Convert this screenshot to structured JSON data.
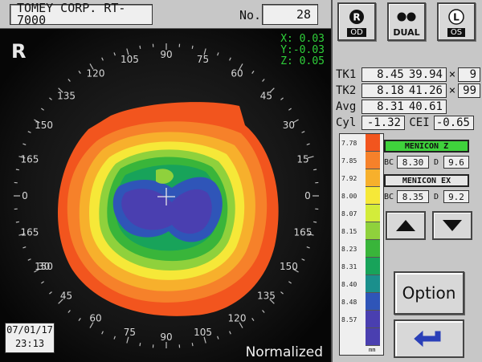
{
  "header": {
    "model": "TOMEY CORP. RT-7000",
    "no_label": "No.",
    "no_value": "28"
  },
  "map": {
    "eye": "R",
    "coords": {
      "x": "X: 0.03",
      "y": "Y:-0.03",
      "z": "Z: 0.05"
    },
    "date": "07/01/17",
    "time": "23:13",
    "mode": "Normalized",
    "angles": [
      "90",
      "105",
      "120",
      "135",
      "150",
      "165",
      "0",
      "165",
      "150",
      "135",
      "120",
      "105",
      "90",
      "75",
      "60",
      "45",
      "30",
      "15",
      "0",
      "15",
      "30",
      "45",
      "60",
      "75"
    ],
    "angle_ticks": [
      {
        "t": "90",
        "a": 90
      },
      {
        "t": "105",
        "a": 105
      },
      {
        "t": "120",
        "a": 120
      },
      {
        "t": "135",
        "a": 135
      },
      {
        "t": "150",
        "a": 150
      },
      {
        "t": "165",
        "a": 165
      },
      {
        "t": "0",
        "a": 180
      },
      {
        "t": "165",
        "a": 195
      },
      {
        "t": "150",
        "a": 210
      },
      {
        "t": "45",
        "a": 225
      },
      {
        "t": "30",
        "a": 210
      },
      {
        "t": "60",
        "a": 240
      },
      {
        "t": "75",
        "a": 255
      },
      {
        "t": "90",
        "a": 270
      },
      {
        "t": "105",
        "a": 285
      },
      {
        "t": "120",
        "a": 300
      },
      {
        "t": "135",
        "a": 315
      },
      {
        "t": "150",
        "a": 330
      },
      {
        "t": "165",
        "a": 345
      },
      {
        "t": "0",
        "a": 0
      },
      {
        "t": "15",
        "a": 15
      },
      {
        "t": "30",
        "a": 30
      },
      {
        "t": "45",
        "a": 45
      },
      {
        "t": "60",
        "a": 60
      },
      {
        "t": "75",
        "a": 75
      }
    ]
  },
  "eye_buttons": {
    "od": {
      "letter": "R",
      "label": "OD"
    },
    "dual": {
      "label": "DUAL"
    },
    "os": {
      "letter": "L",
      "label": "OS"
    }
  },
  "keratometry": {
    "tk1": {
      "label": "TK1",
      "r": "8.45",
      "d": "39.94",
      "axis": "9"
    },
    "tk2": {
      "label": "TK2",
      "r": "8.18",
      "d": "41.26",
      "axis": "99"
    },
    "avg": {
      "label": "Avg",
      "r": "8.31",
      "d": "40.61"
    },
    "cyl": {
      "label": "Cyl",
      "value": "-1.32"
    },
    "cei": {
      "label": "CEI",
      "value": "-0.65"
    },
    "times": "×"
  },
  "scale": {
    "unit": "mm",
    "rows": [
      {
        "label": "7.78",
        "color": "#f2551e"
      },
      {
        "label": "7.85",
        "color": "#f6812a"
      },
      {
        "label": "7.92",
        "color": "#f7b02c"
      },
      {
        "label": "8.00",
        "color": "#f6e838"
      },
      {
        "label": "8.07",
        "color": "#d3ec3a"
      },
      {
        "label": "8.15",
        "color": "#8fd13c"
      },
      {
        "label": "8.23",
        "color": "#39b53a"
      },
      {
        "label": "8.31",
        "color": "#18a35a"
      },
      {
        "label": "8.40",
        "color": "#1a8f8c"
      },
      {
        "label": "8.48",
        "color": "#2f55b8"
      },
      {
        "label": "8.57",
        "color": "#4a3fb0"
      },
      {
        "label": "",
        "color": "#4a3fb0"
      }
    ]
  },
  "lenses": [
    {
      "name": "MENICON Z",
      "bc_label": "BC",
      "bc": "8.30",
      "d_label": "D",
      "d": "9.6",
      "active": true
    },
    {
      "name": "MENICON EX",
      "bc_label": "BC",
      "bc": "8.35",
      "d_label": "D",
      "d": "9.2",
      "active": false
    }
  ],
  "buttons": {
    "option": "Option",
    "up": "up-arrow-icon",
    "down": "down-arrow-icon",
    "back": "return-arrow-icon"
  },
  "colors": {
    "map_bg": "#060606",
    "xyz": "#2fd03a",
    "active_lens": "#3fd23c"
  }
}
